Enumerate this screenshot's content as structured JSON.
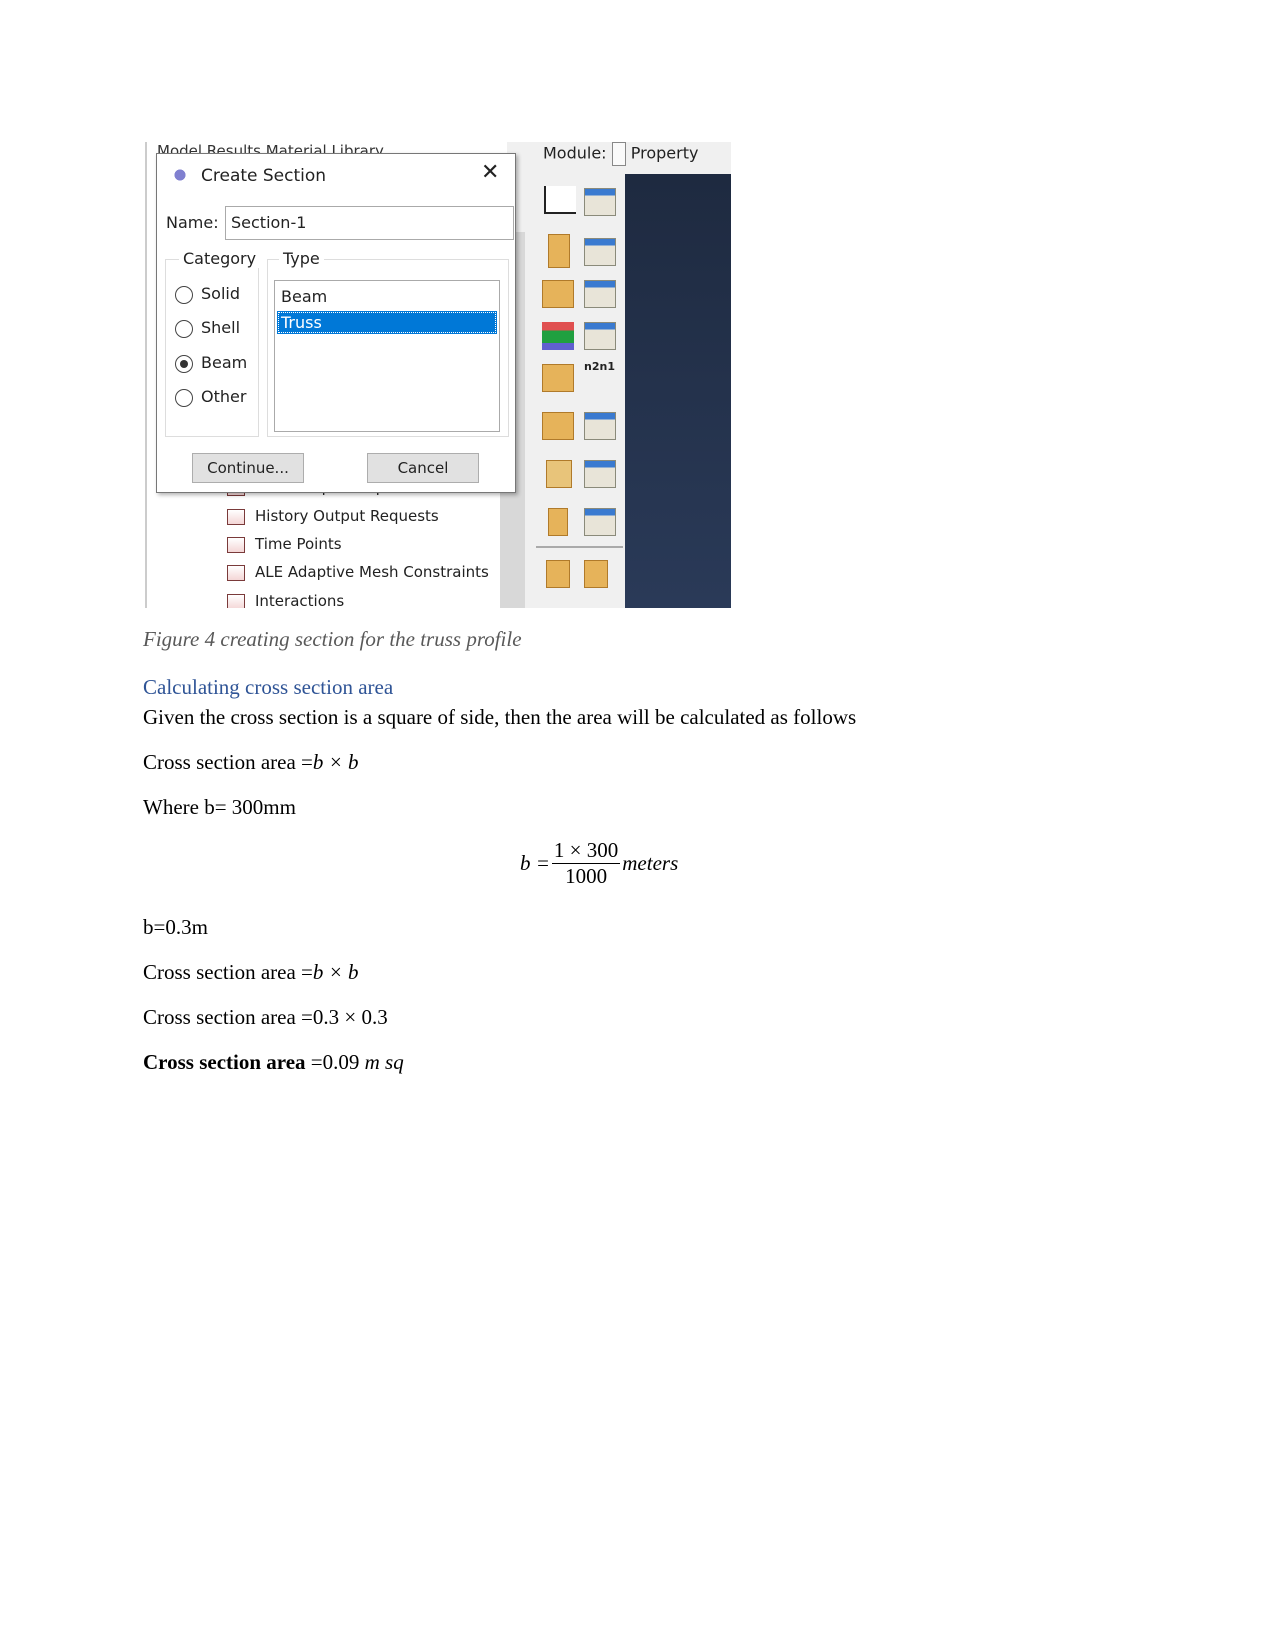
{
  "screenshot": {
    "tabs_partial": "Model  Results  Material Library",
    "module_label": "Module:",
    "module_value": "Property",
    "dialog": {
      "title": "Create Section",
      "name_label": "Name:",
      "name_value": "Section-1",
      "category_label": "Category",
      "categories": [
        {
          "label": "Solid",
          "selected": false
        },
        {
          "label": "Shell",
          "selected": false
        },
        {
          "label": "Beam",
          "selected": true
        },
        {
          "label": "Other",
          "selected": false
        }
      ],
      "type_label": "Type",
      "types": [
        {
          "label": "Beam",
          "selected": false
        },
        {
          "label": "Truss",
          "selected": true
        }
      ],
      "continue_label": "Continue...",
      "cancel_label": "Cancel",
      "selection_color": "#0078d7"
    },
    "tree_items": [
      "Field Output Requests",
      "History Output Requests",
      "Time Points",
      "ALE Adaptive Mesh Constraints",
      "Interactions"
    ]
  },
  "caption": "Figure 4 creating section for the truss profile",
  "heading": "Calculating cross section area",
  "intro": "Given the cross section is a square of side, then the area will be calculated as follows",
  "lines": {
    "l1_text": "Cross section area =",
    "l1_math": "b × b",
    "l2": "Where b= 300mm",
    "eq_lhs": "b =",
    "eq_num": "1 × 300",
    "eq_den": "1000",
    "eq_unit": "meters",
    "l3": "b=0.3m",
    "l4_text": "Cross section area =",
    "l4_math": "b × b",
    "l5_text": "Cross section area =",
    "l5_math": "0.3 × 0.3",
    "l6_text": "Cross section area",
    "l6_eq": " =0.09",
    "l6_unit": "m sq"
  }
}
